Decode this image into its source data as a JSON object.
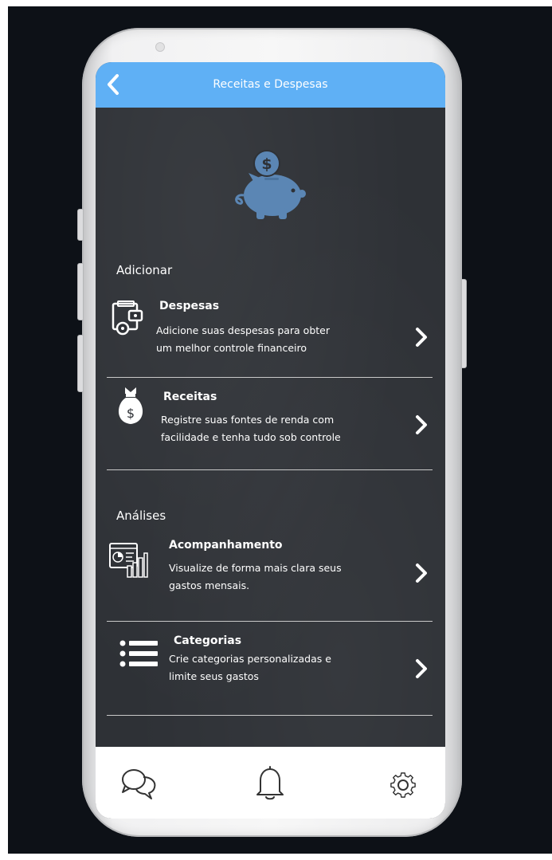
{
  "header": {
    "title": "Receitas e Despesas"
  },
  "sections": {
    "add": {
      "title": "Adicionar",
      "items": [
        {
          "title": "Despesas",
          "desc_line1": "Adicione suas despesas para obter",
          "desc_line2": "um melhor controle financeiro"
        },
        {
          "title": "Receitas",
          "desc_line1": "Registre suas fontes de renda com",
          "desc_line2": "facilidade e tenha tudo sob controle"
        }
      ]
    },
    "analysis": {
      "title": "Análises",
      "items": [
        {
          "title": "Acompanhamento",
          "desc_line1": "Visualize de forma mais clara seus",
          "desc_line2": "gastos mensais."
        },
        {
          "title": "Categorias",
          "desc_line1": "Crie categorias personalizadas e",
          "desc_line2": "limite seus gastos"
        }
      ]
    }
  },
  "colors": {
    "header": "#5fb0f5",
    "screen_bg": "#2e3136",
    "icon_blue": "#5b86b4"
  },
  "bottom_nav": {
    "icons": [
      "chat-icon",
      "bell-icon",
      "gear-icon"
    ]
  }
}
